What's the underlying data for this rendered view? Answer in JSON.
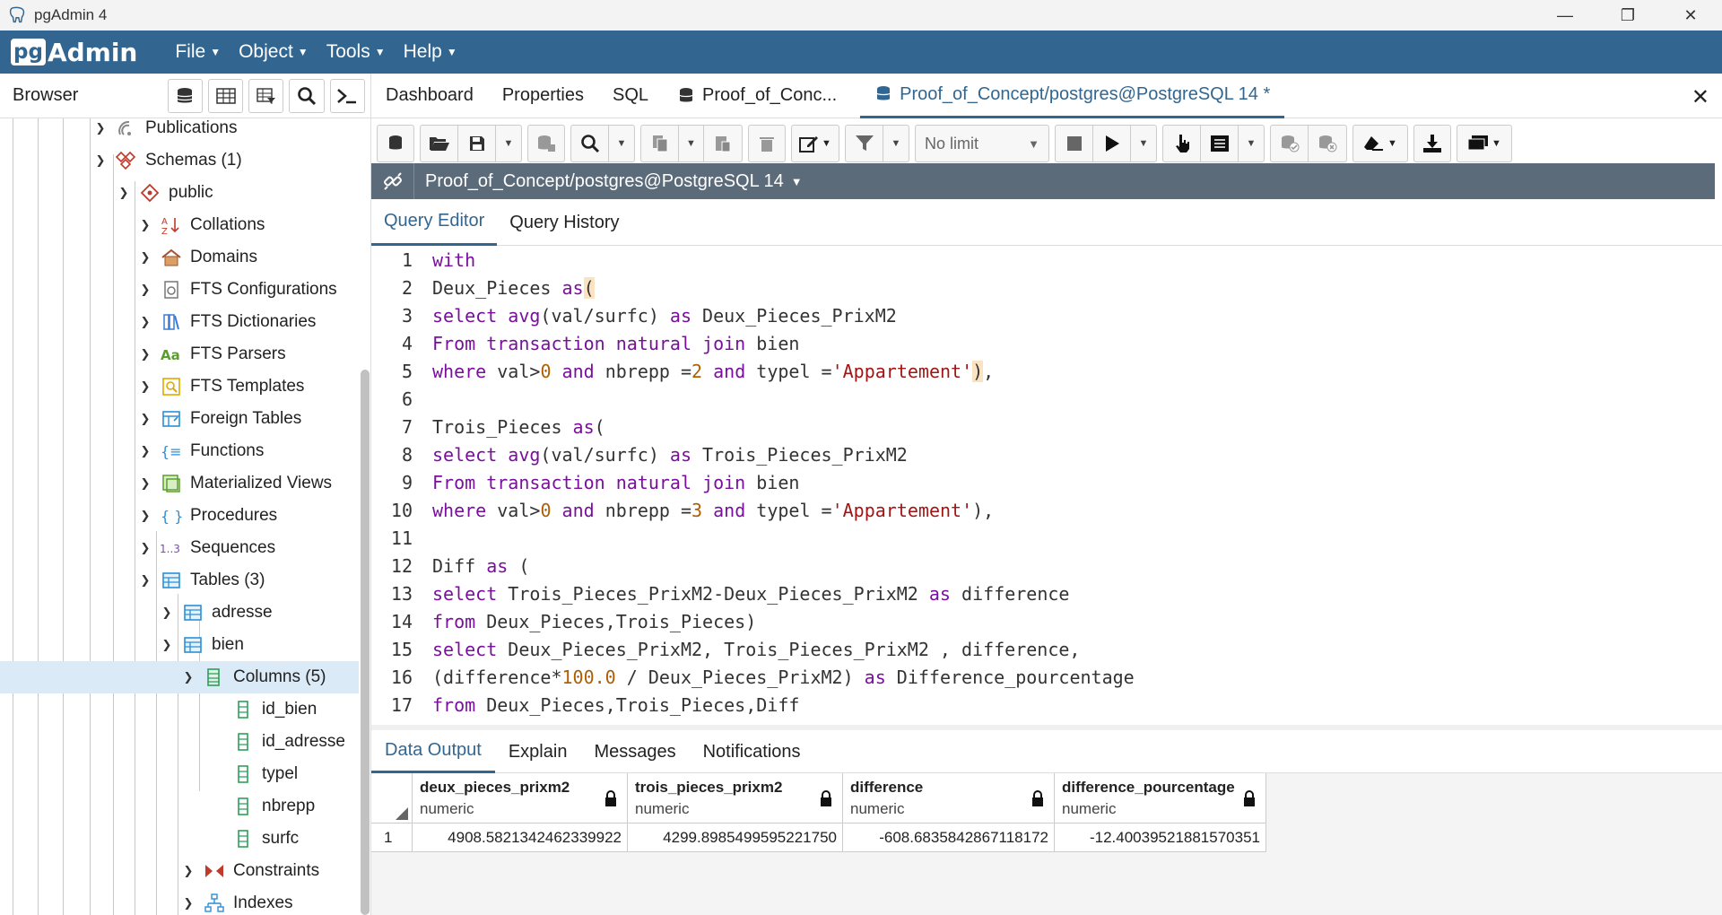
{
  "window": {
    "title": "pgAdmin 4",
    "minimize": "—",
    "maximize": "❐",
    "close": "✕"
  },
  "menubar": {
    "logo_pg": "pg",
    "logo_admin": "Admin",
    "items": [
      {
        "label": "File"
      },
      {
        "label": "Object"
      },
      {
        "label": "Tools"
      },
      {
        "label": "Help"
      }
    ]
  },
  "browser": {
    "title": "Browser",
    "tree": [
      {
        "label": "Publications"
      },
      {
        "label": "Schemas (1)"
      },
      {
        "label": "public"
      },
      {
        "label": "Collations"
      },
      {
        "label": "Domains"
      },
      {
        "label": "FTS Configurations"
      },
      {
        "label": "FTS Dictionaries"
      },
      {
        "label": "FTS Parsers"
      },
      {
        "label": "FTS Templates"
      },
      {
        "label": "Foreign Tables"
      },
      {
        "label": "Functions"
      },
      {
        "label": "Materialized Views"
      },
      {
        "label": "Procedures"
      },
      {
        "label": "Sequences"
      },
      {
        "label": "Tables (3)"
      },
      {
        "label": "adresse"
      },
      {
        "label": "bien"
      },
      {
        "label": "Columns (5)"
      },
      {
        "label": "id_bien"
      },
      {
        "label": "id_adresse"
      },
      {
        "label": "typel"
      },
      {
        "label": "nbrepp"
      },
      {
        "label": "surfc"
      },
      {
        "label": "Constraints"
      },
      {
        "label": "Indexes"
      }
    ]
  },
  "tabs": [
    {
      "label": "Dashboard"
    },
    {
      "label": "Properties"
    },
    {
      "label": "SQL"
    },
    {
      "label": "Proof_of_Conc..."
    },
    {
      "label": "Proof_of_Concept/postgres@PostgreSQL 14 *"
    }
  ],
  "toolbar": {
    "limit": "No limit"
  },
  "connection": {
    "label": "Proof_of_Concept/postgres@PostgreSQL 14"
  },
  "subtabs": [
    {
      "label": "Query Editor"
    },
    {
      "label": "Query History"
    }
  ],
  "editor": {
    "line_numbers": [
      "1",
      "2",
      "3",
      "4",
      "5",
      "6",
      "7",
      "8",
      "9",
      "10",
      "11",
      "12",
      "13",
      "14",
      "15",
      "16",
      "17"
    ]
  },
  "output_tabs": [
    {
      "label": "Data Output"
    },
    {
      "label": "Explain"
    },
    {
      "label": "Messages"
    },
    {
      "label": "Notifications"
    }
  ],
  "grid": {
    "columns": [
      {
        "name": "deux_pieces_prixm2",
        "type": "numeric"
      },
      {
        "name": "trois_pieces_prixm2",
        "type": "numeric"
      },
      {
        "name": "difference",
        "type": "numeric"
      },
      {
        "name": "difference_pourcentage",
        "type": "numeric"
      }
    ],
    "rows": [
      {
        "num": "1",
        "cells": [
          "4908.5821342462339922",
          "4299.8985499595221750",
          "-608.6835842867118172",
          "-12.40039521881570351"
        ]
      }
    ]
  }
}
